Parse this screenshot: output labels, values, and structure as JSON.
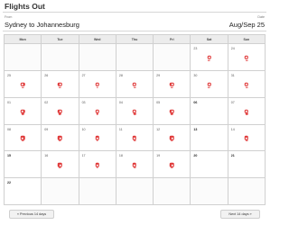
{
  "header": {
    "title": "Flights Out",
    "route_label": "From",
    "date_label": "Date",
    "route": "Sydney to Johannesburg",
    "dates": "Aug/Sep 25"
  },
  "calendar": {
    "weekdays": [
      "Mon",
      "Tue",
      "Wed",
      "Thu",
      "Fri",
      "Sat",
      "Sun"
    ],
    "weeks": [
      [
        {
          "day": "",
          "flight": false
        },
        {
          "day": "",
          "flight": false
        },
        {
          "day": "",
          "flight": false
        },
        {
          "day": "",
          "flight": false
        },
        {
          "day": "",
          "flight": false
        },
        {
          "day": "23",
          "flight": true
        },
        {
          "day": "24",
          "flight": true
        }
      ],
      [
        {
          "day": "25",
          "flight": true
        },
        {
          "day": "26",
          "flight": true
        },
        {
          "day": "27",
          "flight": true
        },
        {
          "day": "28",
          "flight": true
        },
        {
          "day": "29",
          "flight": true
        },
        {
          "day": "30",
          "flight": true
        },
        {
          "day": "31",
          "flight": true
        }
      ],
      [
        {
          "day": "01",
          "flight": true
        },
        {
          "day": "02",
          "flight": true
        },
        {
          "day": "03",
          "flight": true
        },
        {
          "day": "04",
          "flight": true
        },
        {
          "day": "05",
          "flight": true
        },
        {
          "day": "06",
          "flight": false
        },
        {
          "day": "07",
          "flight": true
        }
      ],
      [
        {
          "day": "08",
          "flight": true
        },
        {
          "day": "09",
          "flight": true
        },
        {
          "day": "10",
          "flight": true
        },
        {
          "day": "11",
          "flight": true
        },
        {
          "day": "12",
          "flight": true
        },
        {
          "day": "13",
          "flight": false
        },
        {
          "day": "14",
          "flight": true
        }
      ],
      [
        {
          "day": "15",
          "flight": false
        },
        {
          "day": "16",
          "flight": true
        },
        {
          "day": "17",
          "flight": true
        },
        {
          "day": "18",
          "flight": true
        },
        {
          "day": "19",
          "flight": true
        },
        {
          "day": "20",
          "flight": false
        },
        {
          "day": "21",
          "flight": false
        }
      ],
      [
        {
          "day": "22",
          "flight": false
        },
        {
          "day": "",
          "flight": false
        },
        {
          "day": "",
          "flight": false
        },
        {
          "day": "",
          "flight": false
        },
        {
          "day": "",
          "flight": false
        },
        {
          "day": "",
          "flight": false
        },
        {
          "day": "",
          "flight": false
        }
      ]
    ]
  },
  "nav": {
    "prev_label": "« Previous 14 days",
    "next_label": "Next 14 days »"
  },
  "colors": {
    "flight_icon": "#e03a3a",
    "header_row": "#ececec",
    "grid_line": "#d0d0d0"
  }
}
